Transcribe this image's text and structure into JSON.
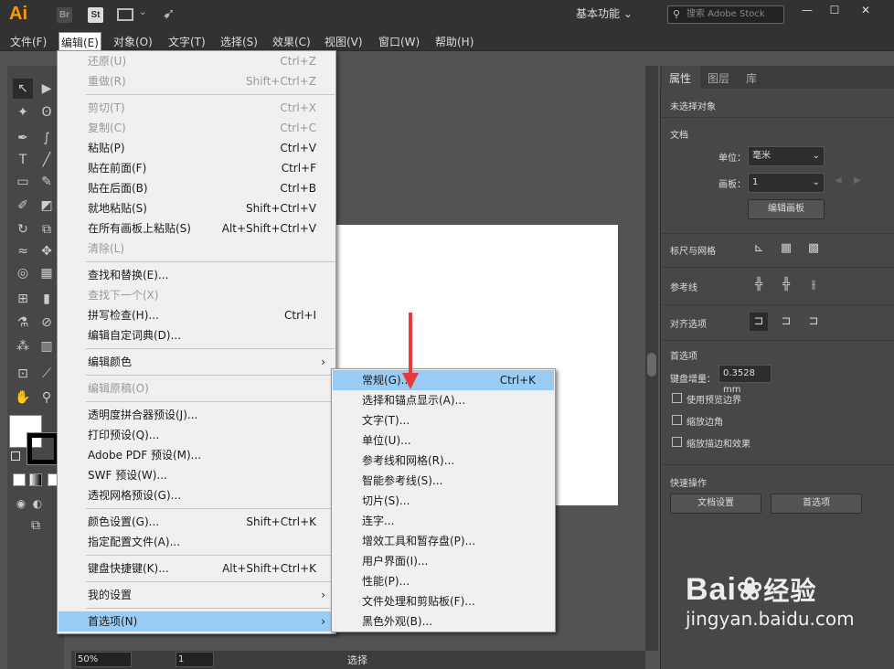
{
  "titlebar": {
    "app_logo": "Ai",
    "bridge": "Br",
    "stock": "St",
    "workspace": "基本功能",
    "search_placeholder": "搜索 Adobe Stock"
  },
  "menubar": [
    "文件(F)",
    "编辑(E)",
    "对象(O)",
    "文字(T)",
    "选择(S)",
    "效果(C)",
    "视图(V)",
    "窗口(W)",
    "帮助(H)"
  ],
  "edit_menu": [
    {
      "label": "还原(U)",
      "shortcut": "Ctrl+Z",
      "disabled": true
    },
    {
      "label": "重做(R)",
      "shortcut": "Shift+Ctrl+Z",
      "disabled": true
    },
    {
      "label": "剪切(T)",
      "shortcut": "Ctrl+X",
      "disabled": true
    },
    {
      "label": "复制(C)",
      "shortcut": "Ctrl+C",
      "disabled": true
    },
    {
      "label": "粘贴(P)",
      "shortcut": "Ctrl+V"
    },
    {
      "label": "贴在前面(F)",
      "shortcut": "Ctrl+F"
    },
    {
      "label": "贴在后面(B)",
      "shortcut": "Ctrl+B"
    },
    {
      "label": "就地粘贴(S)",
      "shortcut": "Shift+Ctrl+V"
    },
    {
      "label": "在所有画板上粘贴(S)",
      "shortcut": "Alt+Shift+Ctrl+V"
    },
    {
      "label": "清除(L)",
      "shortcut": "",
      "disabled": true
    },
    {
      "label": "查找和替换(E)...",
      "shortcut": ""
    },
    {
      "label": "查找下一个(X)",
      "shortcut": "",
      "disabled": true
    },
    {
      "label": "拼写检查(H)...",
      "shortcut": "Ctrl+I"
    },
    {
      "label": "编辑自定词典(D)...",
      "shortcut": ""
    },
    {
      "label": "编辑颜色",
      "shortcut": "",
      "submenu": true
    },
    {
      "label": "编辑原稿(O)",
      "shortcut": "",
      "disabled": true
    },
    {
      "label": "透明度拼合器预设(J)...",
      "shortcut": ""
    },
    {
      "label": "打印预设(Q)...",
      "shortcut": ""
    },
    {
      "label": "Adobe PDF 预设(M)...",
      "shortcut": ""
    },
    {
      "label": "SWF 预设(W)...",
      "shortcut": ""
    },
    {
      "label": "透视网格预设(G)...",
      "shortcut": ""
    },
    {
      "label": "颜色设置(G)...",
      "shortcut": "Shift+Ctrl+K"
    },
    {
      "label": "指定配置文件(A)...",
      "shortcut": ""
    },
    {
      "label": "键盘快捷键(K)...",
      "shortcut": "Alt+Shift+Ctrl+K"
    },
    {
      "label": "我的设置",
      "shortcut": "",
      "submenu": true
    },
    {
      "label": "首选项(N)",
      "shortcut": "",
      "submenu": true,
      "highlighted": true
    }
  ],
  "pref_menu": [
    {
      "label": "常规(G)...",
      "shortcut": "Ctrl+K",
      "highlighted": true
    },
    {
      "label": "选择和锚点显示(A)...",
      "shortcut": ""
    },
    {
      "label": "文字(T)...",
      "shortcut": ""
    },
    {
      "label": "单位(U)...",
      "shortcut": ""
    },
    {
      "label": "参考线和网格(R)...",
      "shortcut": ""
    },
    {
      "label": "智能参考线(S)...",
      "shortcut": ""
    },
    {
      "label": "切片(S)...",
      "shortcut": ""
    },
    {
      "label": "连字...",
      "shortcut": ""
    },
    {
      "label": "增效工具和暂存盘(P)...",
      "shortcut": ""
    },
    {
      "label": "用户界面(I)...",
      "shortcut": ""
    },
    {
      "label": "性能(P)...",
      "shortcut": ""
    },
    {
      "label": "文件处理和剪贴板(F)...",
      "shortcut": ""
    },
    {
      "label": "黑色外观(B)...",
      "shortcut": ""
    }
  ],
  "panel": {
    "tabs": [
      "属性",
      "图层",
      "库"
    ],
    "no_selection": "未选择对象",
    "document": "文档",
    "unit_label": "单位：",
    "unit_value": "毫米",
    "artboard_label": "画板：",
    "artboard_value": "1",
    "edit_artboard": "编辑画板",
    "rulers_grid": "标尺与网格",
    "guides": "参考线",
    "align_options": "对齐选项",
    "preferences": "首选项",
    "keyboard_increment_label": "键盘增量：",
    "keyboard_increment_value": "0.3528 mm",
    "use_preview_bounds": "使用预览边界",
    "scale_corners": "缩放边角",
    "scale_strokes": "缩放描边和效果",
    "quick_actions": "快速操作",
    "doc_setup_btn": "文档设置",
    "preferences_btn": "首选项"
  },
  "status": {
    "zoom": "50%",
    "page": "1",
    "tool": "选择"
  },
  "watermark": {
    "brand": "Bai",
    "brand2": "经验",
    "url": "jingyan.baidu.com"
  },
  "colors": {
    "accent": "#ff9a00",
    "highlight": "#99ccf5",
    "arrow": "#e83a3a"
  }
}
